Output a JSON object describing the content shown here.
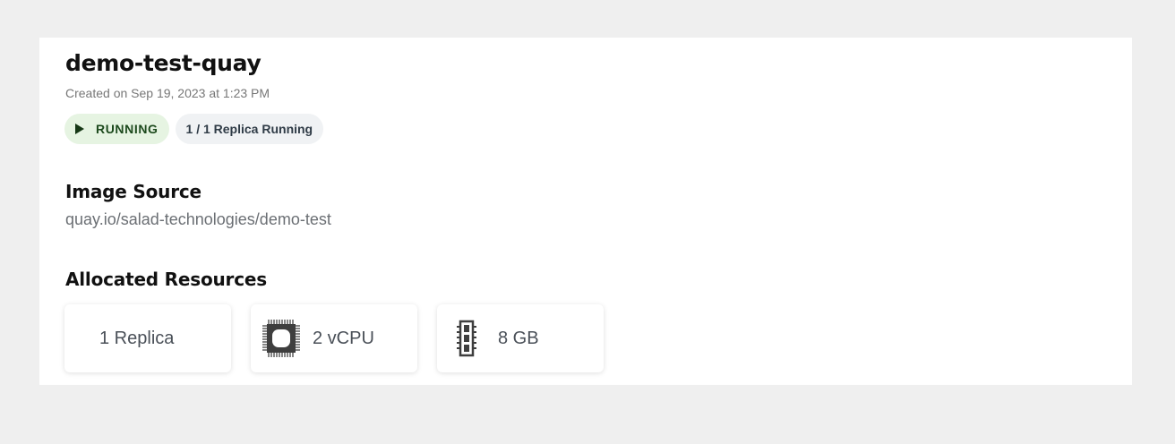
{
  "container": {
    "name": "demo-test-quay",
    "created": "Created on Sep 19, 2023 at 1:23 PM",
    "status": {
      "label": "RUNNING",
      "icon": "play-icon",
      "color": "#e6f4e2"
    },
    "replicas_running": "1 / 1 Replica Running"
  },
  "image_source": {
    "heading": "Image Source",
    "value": "quay.io/salad-technologies/demo-test"
  },
  "resources": {
    "heading": "Allocated Resources",
    "items": [
      {
        "label": "1 Replica",
        "icon": ""
      },
      {
        "label": "2 vCPU",
        "icon": "cpu-icon"
      },
      {
        "label": "8 GB",
        "icon": "memory-icon"
      }
    ]
  }
}
